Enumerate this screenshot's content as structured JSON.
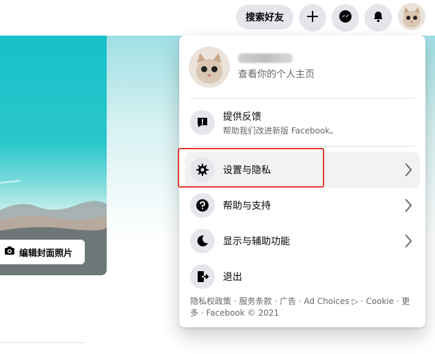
{
  "header": {
    "find_friends": "搜索好友"
  },
  "cover": {
    "edit_cover_label": "编辑封面照片"
  },
  "menu": {
    "profile_sub": "查看你的个人主页",
    "feedback": {
      "title": "提供反馈",
      "sub": "帮助我们改进新版 Facebook。"
    },
    "items": [
      {
        "label": "设置与隐私"
      },
      {
        "label": "帮助与支持"
      },
      {
        "label": "显示与辅助功能"
      },
      {
        "label": "退出"
      }
    ],
    "footer": "隐私权政策 · 服务条款 · 广告 · Ad Choices ▷ · Cookie · 更多 · Facebook © 2021"
  },
  "colors": {
    "highlight": "#e03a2f",
    "icon_bg": "#e4e6eb",
    "secondary_text": "#65676b"
  }
}
